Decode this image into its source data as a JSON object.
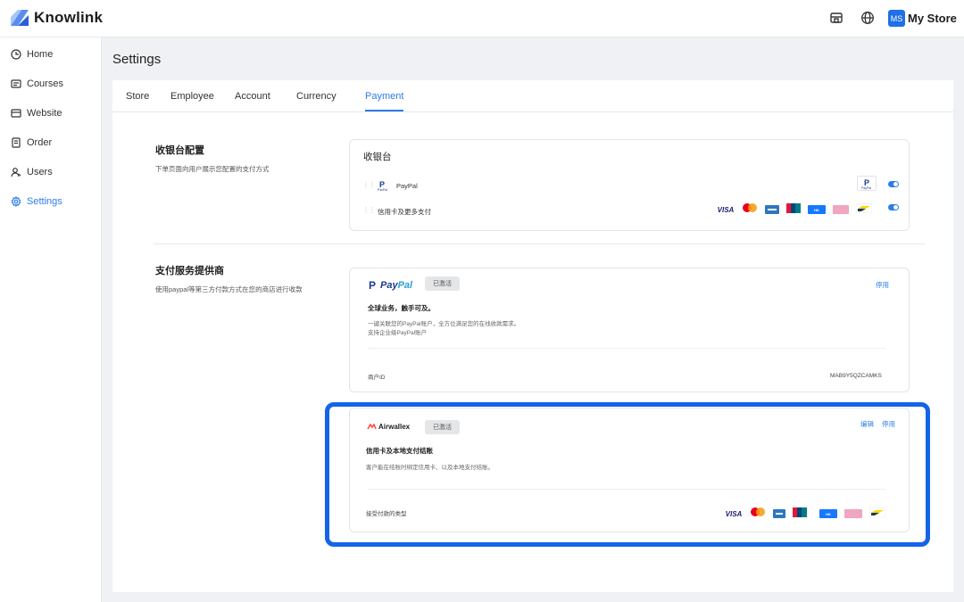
{
  "app": {
    "name": "Knowlink"
  },
  "header": {
    "store_initials": "MS",
    "store_name": "My Store",
    "icons": [
      "storefront-icon",
      "globe-icon"
    ]
  },
  "sidebar": {
    "items": [
      {
        "label": "Home",
        "icon": "clock-icon"
      },
      {
        "label": "Courses",
        "icon": "courses-icon"
      },
      {
        "label": "Website",
        "icon": "storefront-icon"
      },
      {
        "label": "Order",
        "icon": "order-icon"
      },
      {
        "label": "Users",
        "icon": "users-icon"
      },
      {
        "label": "Settings",
        "icon": "gear-icon",
        "active": true
      }
    ]
  },
  "page": {
    "title": "Settings"
  },
  "tabs": [
    "Store",
    "Employee",
    "Account",
    "Currency",
    "Payment"
  ],
  "active_tab": "Payment",
  "checkout_section": {
    "title": "收银台配置",
    "desc": "下单页面向用户展示您配置的支付方式",
    "card_title": "收银台",
    "rows": [
      {
        "label": "PayPal",
        "enabled": true
      },
      {
        "label": "信用卡及更多支付",
        "enabled": true
      }
    ]
  },
  "providers_section": {
    "title": "支付服务提供商",
    "desc": "使用paypal等第三方付款方式在您的商店进行收款"
  },
  "paypal_card": {
    "brand": "PayPal",
    "status": "已激活",
    "action_disable": "停用",
    "headline": "全球业务，触手可及。",
    "desc_line1": "一键关联您的PayPal账户，全方位满足您的在线收款需求。",
    "desc_line2": "支持企业级PayPal账户",
    "merchant_label": "商户ID",
    "merchant_id": "MAB9Y5QZCAMKS"
  },
  "airwallex_card": {
    "brand": "Airwallex",
    "status": "已激活",
    "action_edit": "编辑",
    "action_disable": "停用",
    "headline": "信用卡及本地支付结账",
    "desc": "客户能在结账时绑定信用卡、以及本地支付结账。",
    "accepted_label": "接受付款的类型"
  },
  "payment_method_logos": [
    "VISA",
    "mastercard",
    "amex",
    "unionpay",
    "alipay-hk",
    "afterpay",
    "bancontact"
  ],
  "colors": {
    "accent": "#2b7de9",
    "highlight": "#1464e8",
    "badge_bg": "#e5e6e8"
  }
}
